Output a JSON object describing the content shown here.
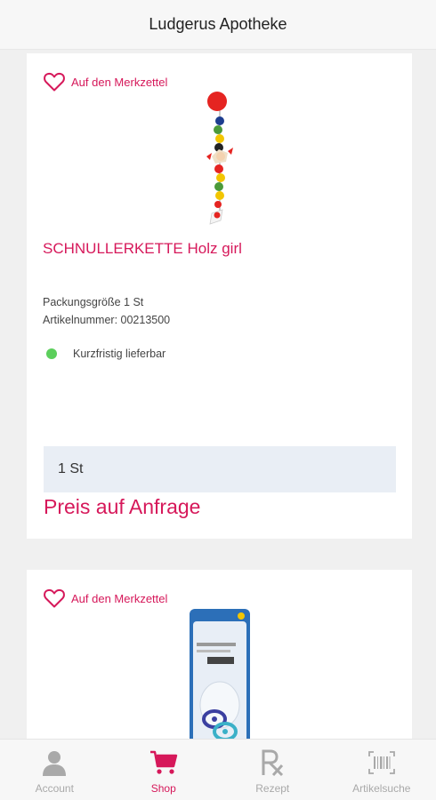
{
  "header": {
    "title": "Ludgerus Apotheke"
  },
  "products": [
    {
      "wishlist_label": "Auf den Merkzettel",
      "title": "SCHNULLERKETTE Holz girl",
      "package_size": "Packungsgröße 1 St",
      "article_number": "Artikelnummer: 00213500",
      "availability": "Kurzfristig lieferbar",
      "quantity": "1 St",
      "price": "Preis auf Anfrage"
    },
    {
      "wishlist_label": "Auf den Merkzettel"
    }
  ],
  "bottom_nav": {
    "items": [
      {
        "label": "Account",
        "icon": "person-icon",
        "active": false
      },
      {
        "label": "Shop",
        "icon": "cart-icon",
        "active": true
      },
      {
        "label": "Rezept",
        "icon": "prescription-icon",
        "active": false
      },
      {
        "label": "Artikelsuche",
        "icon": "barcode-icon",
        "active": false
      }
    ]
  },
  "colors": {
    "accent": "#d6185a",
    "available": "#5ccf5c",
    "inactive": "#a9a9a9"
  }
}
